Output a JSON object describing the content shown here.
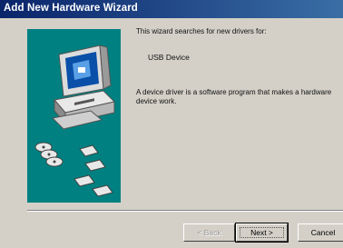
{
  "window": {
    "title": "Add New Hardware Wizard"
  },
  "content": {
    "intro": "This wizard searches for new drivers for:",
    "device_name": "USB Device",
    "description": "A device driver is a software program that makes a hardware device work."
  },
  "buttons": {
    "back": "< Back",
    "next": "Next >",
    "cancel": "Cancel"
  },
  "colors": {
    "titlebar_start": "#0a246a",
    "titlebar_end": "#3a6ea5",
    "panel": "#008080",
    "face": "#d4d0c8"
  },
  "icons": {
    "illustration": "computer-with-floppy-disks"
  }
}
